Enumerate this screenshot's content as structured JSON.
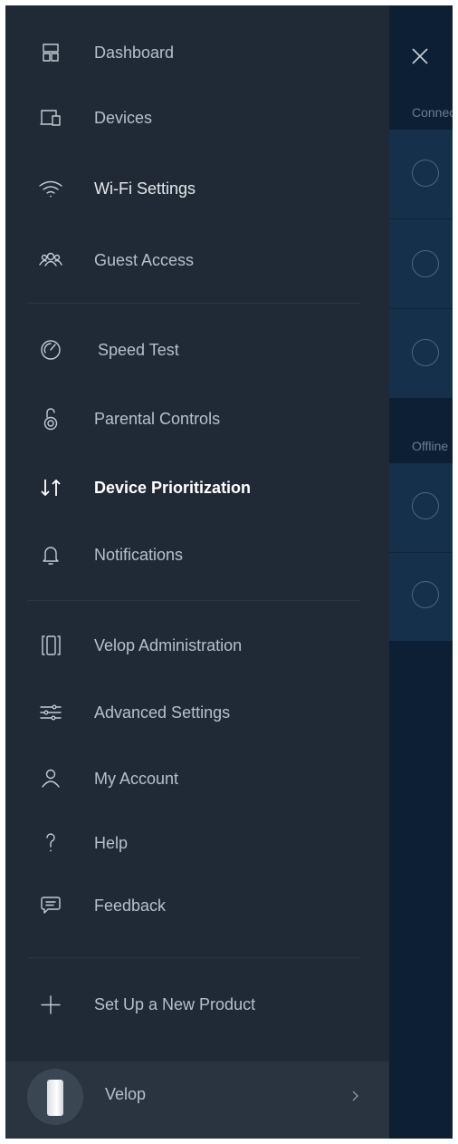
{
  "menu": {
    "items": [
      {
        "label": "Dashboard",
        "icon": "dashboard-icon"
      },
      {
        "label": "Devices",
        "icon": "devices-icon"
      },
      {
        "label": "Wi-Fi Settings",
        "icon": "wifi-icon"
      },
      {
        "label": "Guest Access",
        "icon": "guest-access-icon"
      },
      {
        "label": "Speed Test",
        "icon": "speedometer-icon"
      },
      {
        "label": "Parental Controls",
        "icon": "parental-controls-icon"
      },
      {
        "label": "Device Prioritization",
        "icon": "prioritization-arrows-icon"
      },
      {
        "label": "Notifications",
        "icon": "bell-icon"
      },
      {
        "label": "Velop Administration",
        "icon": "velop-node-icon"
      },
      {
        "label": "Advanced Settings",
        "icon": "sliders-icon"
      },
      {
        "label": "My Account",
        "icon": "person-icon"
      },
      {
        "label": "Help",
        "icon": "question-icon"
      },
      {
        "label": "Feedback",
        "icon": "feedback-icon"
      },
      {
        "label": "Set Up a New Product",
        "icon": "plus-icon"
      }
    ],
    "active": "Device Prioritization"
  },
  "footer": {
    "label": "Velop",
    "icon": "velop-node-image"
  },
  "background": {
    "connected_label": "Connected",
    "offline_label": "Offline"
  },
  "colors": {
    "drawer": "#202a37",
    "background_panel": "#0d1f32",
    "device_block": "#14304a",
    "text": "#b7c0c9",
    "active_text": "#ffffff"
  }
}
